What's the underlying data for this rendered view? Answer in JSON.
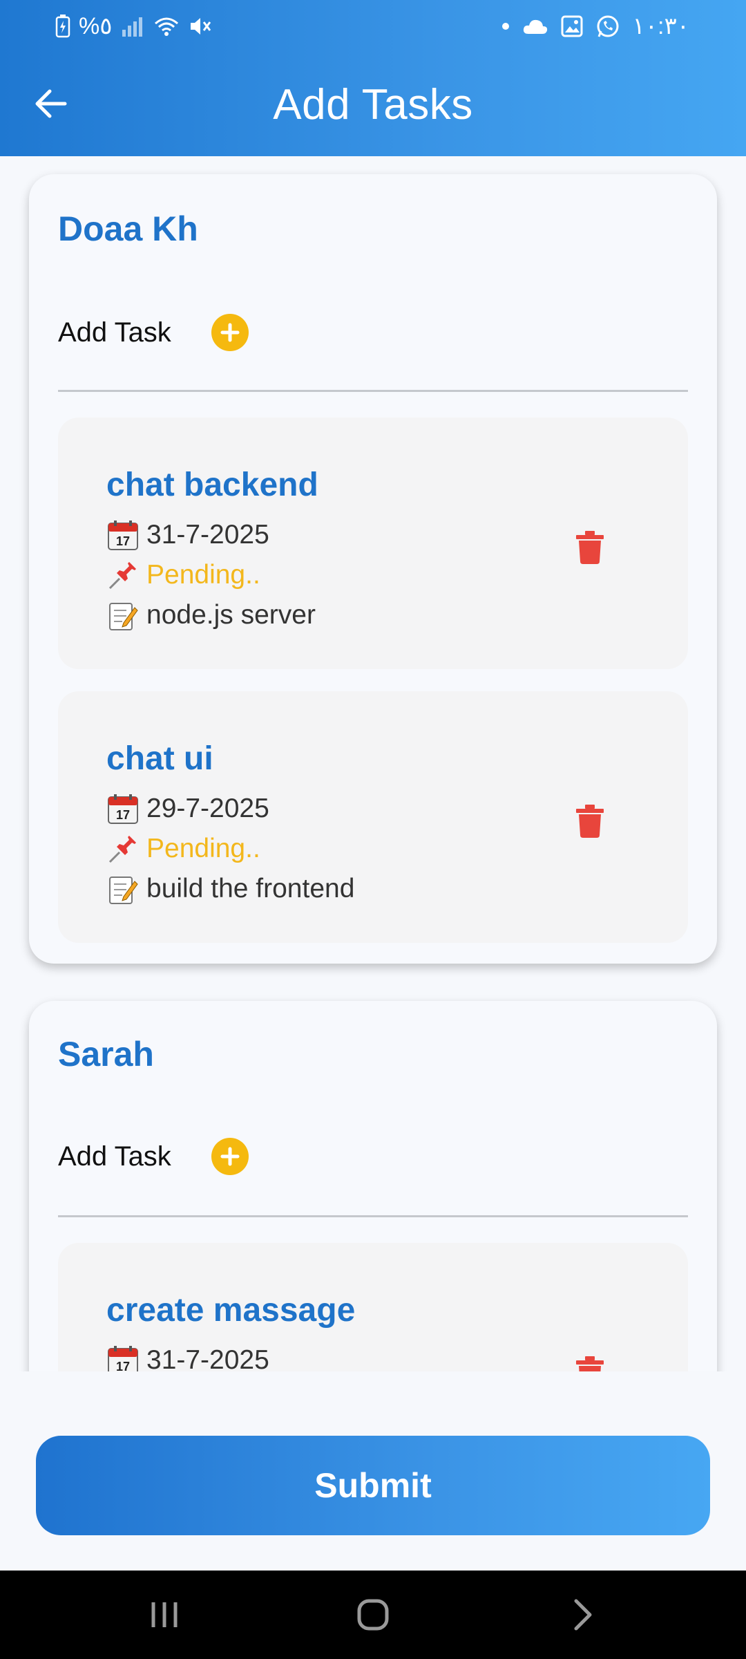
{
  "status_bar": {
    "battery_text": "%٥",
    "time": "١٠:٣٠",
    "icons_left": [
      "battery-charging-icon",
      "signal-icon",
      "wifi-icon",
      "mute-icon"
    ],
    "icons_right": [
      "dot-icon",
      "cloud-icon",
      "image-icon",
      "whatsapp-icon"
    ]
  },
  "header": {
    "title": "Add Tasks",
    "back_icon": "arrow-left-icon"
  },
  "members": [
    {
      "name": "Doaa Kh",
      "add_task_label": "Add Task",
      "tasks": [
        {
          "title": "chat backend",
          "date": "31-7-2025",
          "status": "Pending..",
          "description": "node.js server"
        },
        {
          "title": "chat ui",
          "date": "29-7-2025",
          "status": "Pending..",
          "description": "build the frontend"
        }
      ]
    },
    {
      "name": "Sarah",
      "add_task_label": "Add Task",
      "tasks": [
        {
          "title": "create massage",
          "date": "31-7-2025",
          "status": "",
          "description": ""
        }
      ]
    }
  ],
  "submit_label": "Submit",
  "colors": {
    "primary": "#1f73c9",
    "accent_yellow": "#f5b90f",
    "pending": "#f3b71c",
    "delete_red": "#e8453c"
  }
}
